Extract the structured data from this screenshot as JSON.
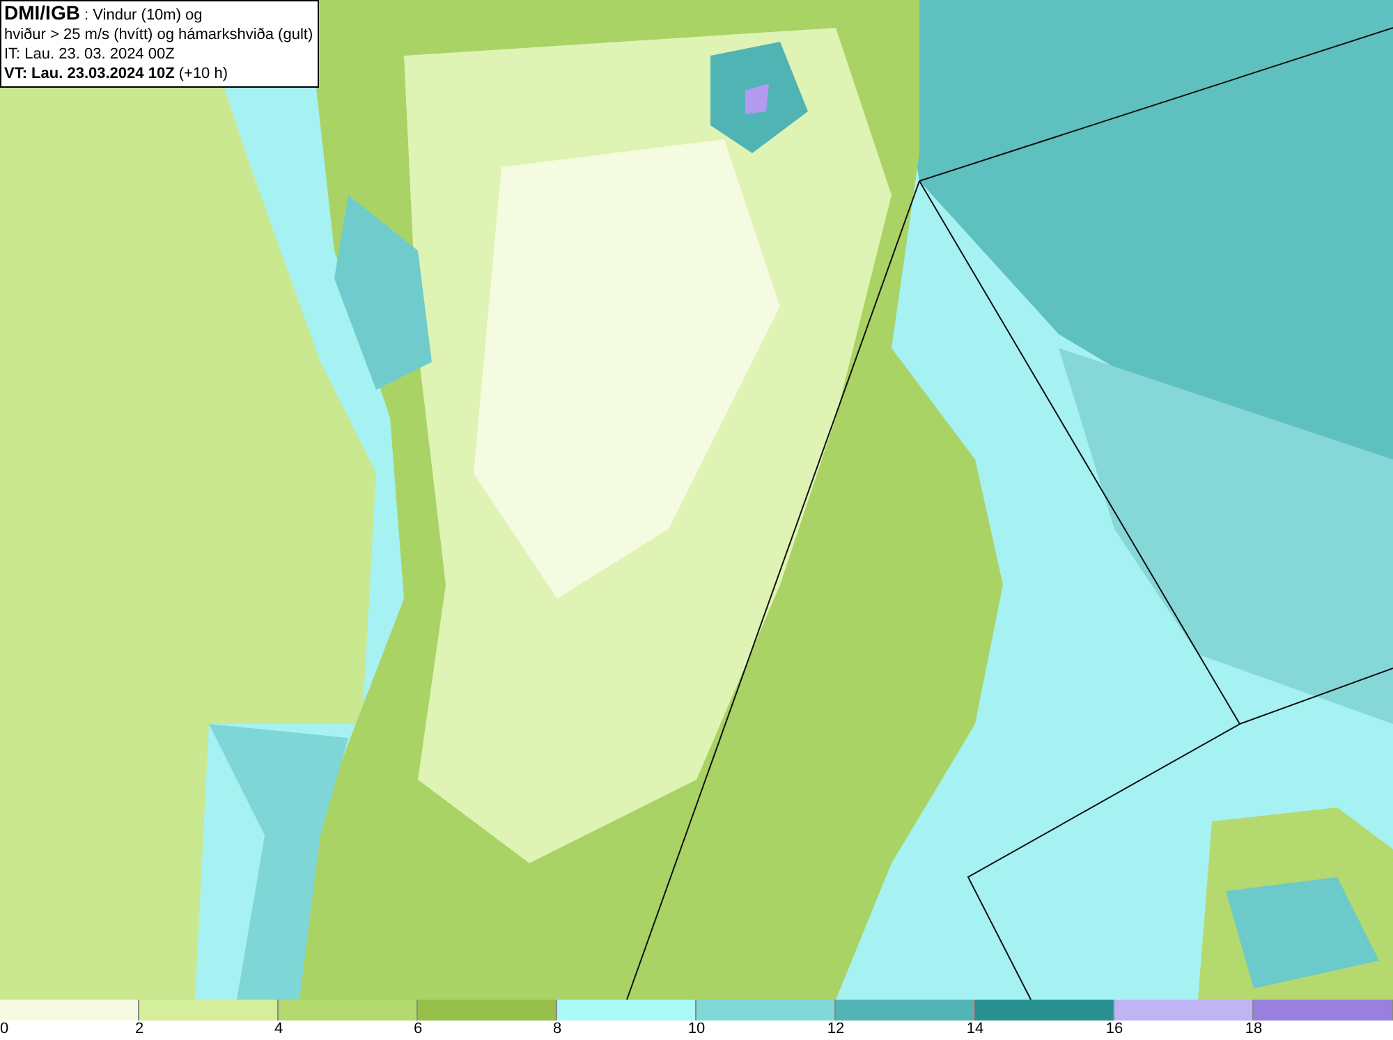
{
  "info_box": {
    "lines": [
      "**DMI/IGB** : Vindur (10m) og",
      "hviður > 25 m/s (hvítt) og hámarkshviða (gult)",
      "IT: Lau. 23. 03. 2024 00Z",
      "**VT: Lau. 23.03.2024 10Z** (+10 h)"
    ]
  },
  "legend": {
    "bins": [
      {
        "color": "#f5fbe0"
      },
      {
        "color": "#d4ee9c"
      },
      {
        "color": "#b4d96f"
      },
      {
        "color": "#97c04a"
      },
      {
        "color": "#aaf8f8"
      },
      {
        "color": "#80d8d8"
      },
      {
        "color": "#52b4b4"
      },
      {
        "color": "#289090"
      },
      {
        "color": "#c0b4f4"
      },
      {
        "color": "#9a80de"
      }
    ],
    "labels": [
      "0",
      "2",
      "4",
      "6",
      "8",
      "10",
      "12",
      "14",
      "16",
      "18"
    ]
  }
}
